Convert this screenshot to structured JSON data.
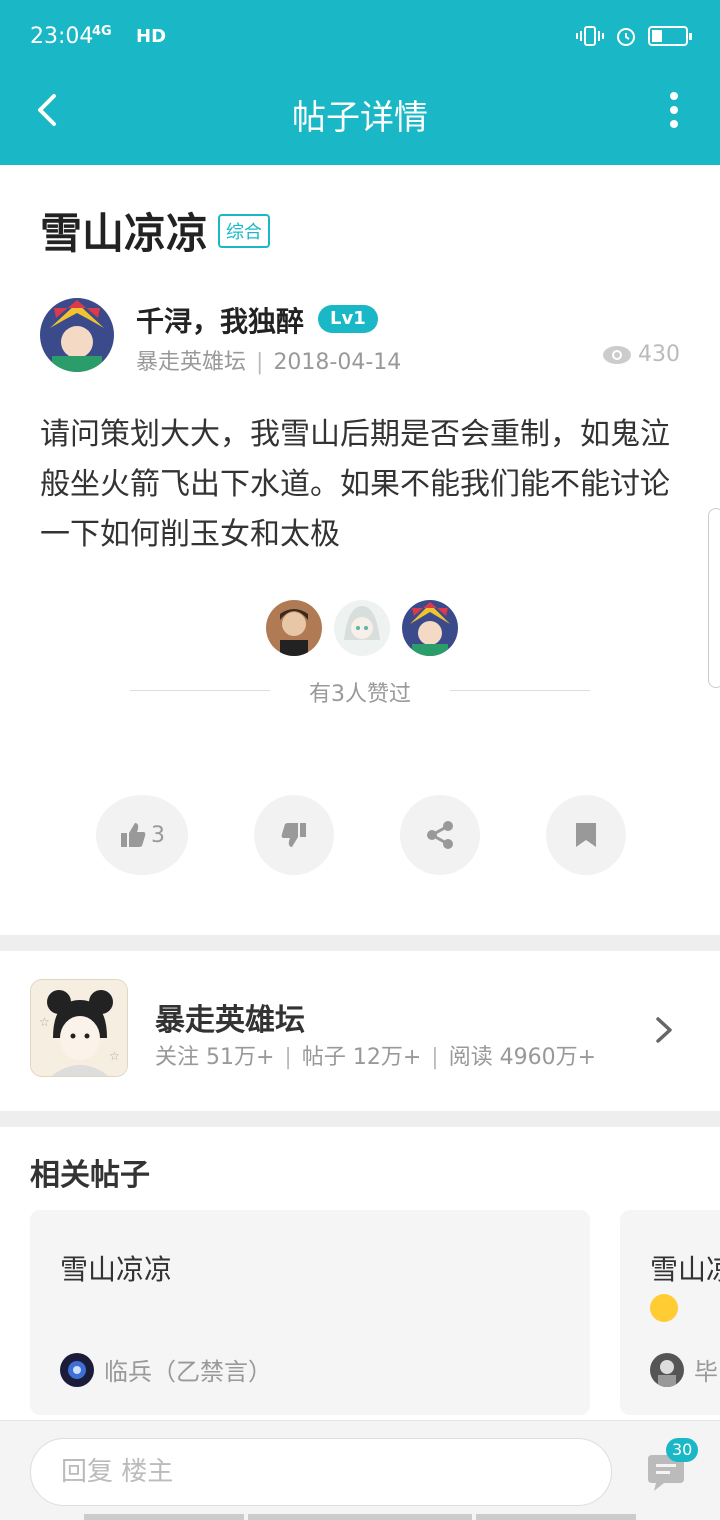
{
  "status_bar": {
    "time": "23:04",
    "network": "4G",
    "hd": "HD",
    "battery_level": 0.3
  },
  "app_bar": {
    "title": "帖子详情"
  },
  "post": {
    "title": "雪山凉凉",
    "tag": "综合",
    "author": {
      "name": "千浔，我独醉",
      "level": "Lv1"
    },
    "forum": "暴走英雄坛",
    "meta_sep": "|",
    "date": "2018-04-14",
    "views": "430",
    "body": "请问策划大大，我雪山后期是否会重制，如鬼泣般坐火箭飞出下水道。如果不能我们能不能讨论一下如何削玉女和太极",
    "likes_text": "有3人赞过"
  },
  "actions": {
    "like_count": "3"
  },
  "forum_card": {
    "name": "暴走英雄坛",
    "follow": "关注 51万+",
    "posts": "帖子 12万+",
    "reads": "阅读 4960万+",
    "sep": "|"
  },
  "related": {
    "title": "相关帖子",
    "cards": [
      {
        "title": "雪山凉凉",
        "user": "临兵（乙禁言）"
      },
      {
        "title": "雪山凉",
        "user": "毕"
      }
    ]
  },
  "reply": {
    "placeholder": "回复  楼主",
    "comment_badge": "30"
  },
  "colors": {
    "accent": "#1ab8c6",
    "divider": "#eeeeee"
  },
  "icons": [
    "back-arrow-icon",
    "more-vert-icon",
    "eye-icon",
    "thumbs-up-icon",
    "thumbs-down-icon",
    "share-icon",
    "bookmark-icon",
    "chevron-right-icon",
    "comment-icon"
  ]
}
